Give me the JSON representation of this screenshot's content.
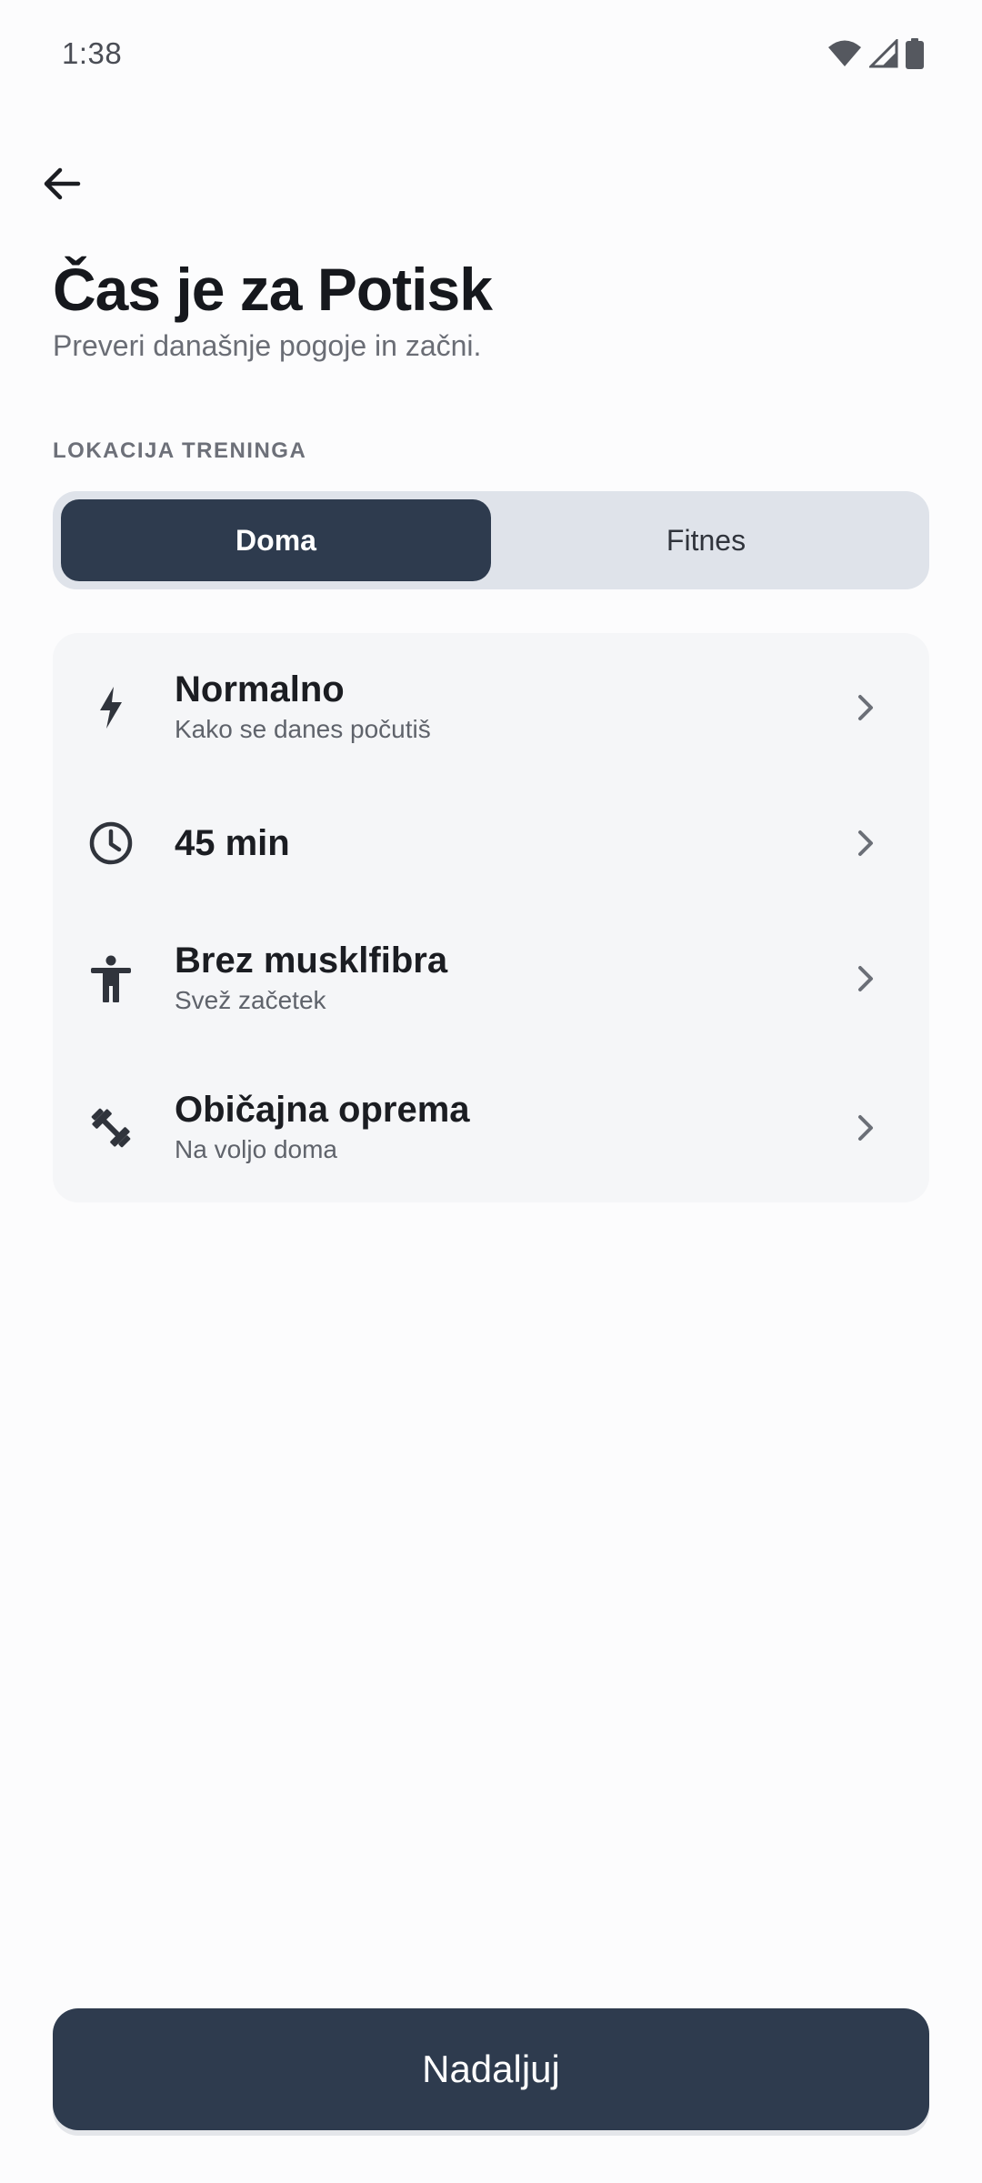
{
  "status_bar": {
    "time": "1:38",
    "icons": [
      "wifi-icon",
      "cellular-signal-icon",
      "battery-icon"
    ]
  },
  "header": {
    "back_icon": "arrow-left-icon",
    "title": "Čas je za Potisk",
    "subtitle": "Preveri današnje pogoje in začni."
  },
  "location": {
    "label": "LOKACIJA TRENINGA",
    "options": [
      {
        "label": "Doma",
        "selected": true
      },
      {
        "label": "Fitnes",
        "selected": false
      }
    ]
  },
  "options": [
    {
      "icon": "lightning-bolt-icon",
      "title": "Normalno",
      "subtitle": "Kako se danes počutiš"
    },
    {
      "icon": "clock-icon",
      "title": "45 min",
      "subtitle": ""
    },
    {
      "icon": "person-icon",
      "title": "Brez musklfibra",
      "subtitle": "Svež začetek"
    },
    {
      "icon": "dumbbell-icon",
      "title": "Običajna oprema",
      "subtitle": "Na voljo doma"
    }
  ],
  "footer": {
    "continue_label": "Nadaljuj"
  },
  "colors": {
    "primary": "#2e3b4e",
    "background": "#fcfcfd",
    "card": "#f5f6f8",
    "segment_track": "#dfe3ea"
  }
}
